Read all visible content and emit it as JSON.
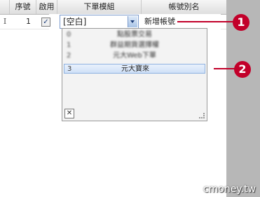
{
  "columns": {
    "seq": "序號",
    "enabled": "啟用",
    "template": "下單模組",
    "alias": "帳號別名"
  },
  "row": {
    "cursor": "I",
    "seq": "1",
    "checkbox_mark": "✓",
    "combo_value": "[空白]",
    "alias": "新增帳號"
  },
  "dropdown": {
    "items": [
      {
        "num": "0",
        "name": "點股票交易"
      },
      {
        "num": "1",
        "name": "群益期貨選擇權"
      },
      {
        "num": "2",
        "name": "元大Web下單"
      },
      {
        "num": "3",
        "name": "元大寶來"
      }
    ],
    "close_glyph": "✕"
  },
  "callouts": {
    "one": "1",
    "two": "2"
  },
  "watermark": "cmoney.tw",
  "colors": {
    "accent": "#c2002a",
    "selection": "#cfe0f7"
  }
}
